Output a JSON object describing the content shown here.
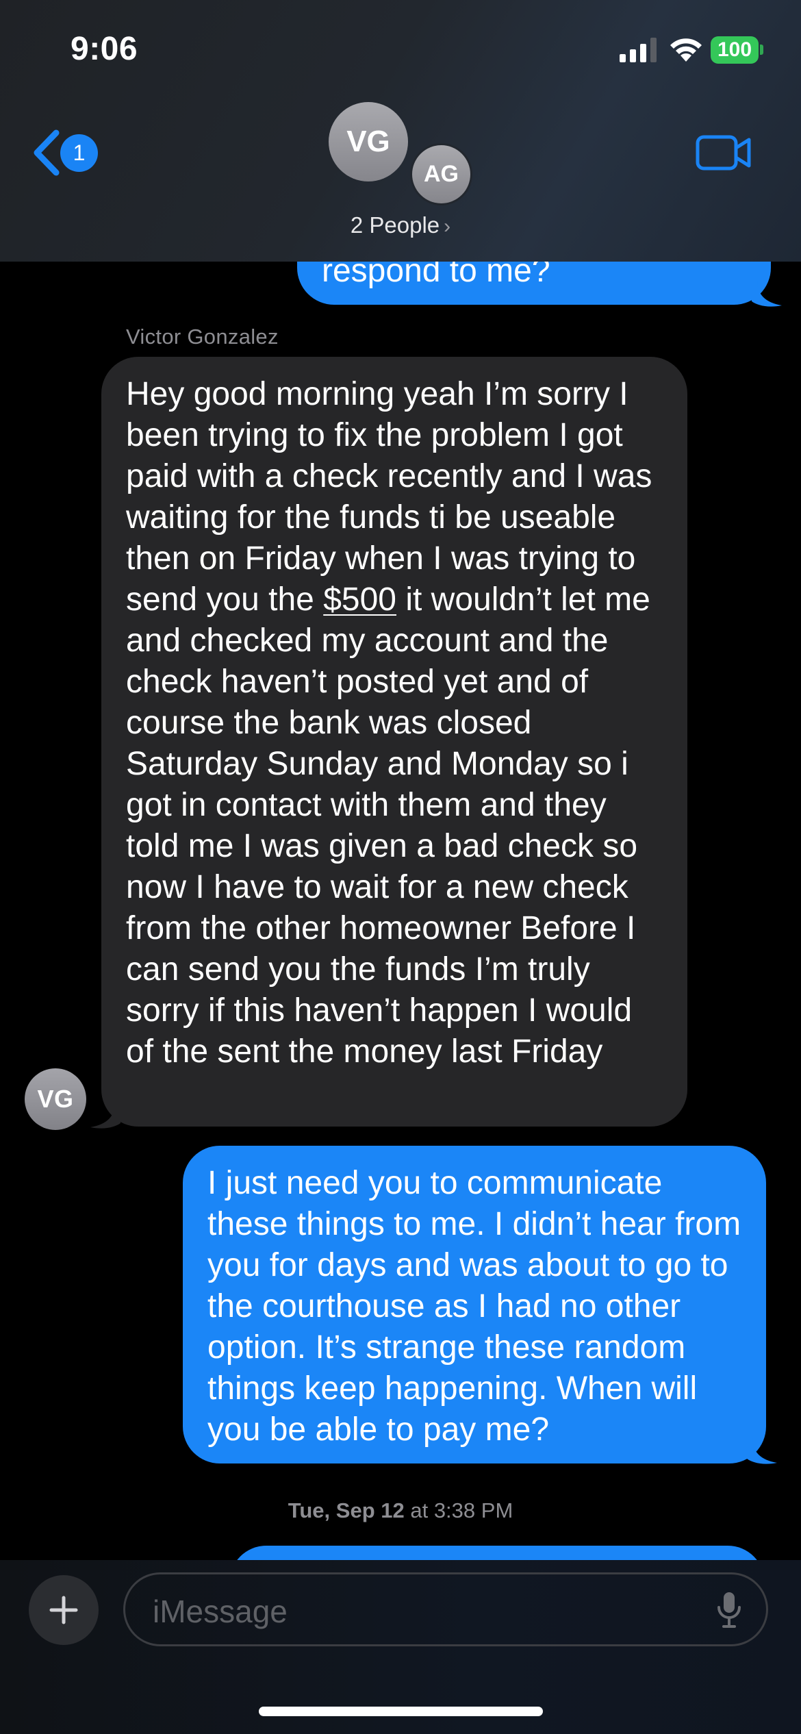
{
  "status_bar": {
    "time": "9:06",
    "battery": "100"
  },
  "header": {
    "back_badge_count": "1",
    "participants": [
      {
        "initials": "VG"
      },
      {
        "initials": "AG"
      }
    ],
    "people_label": "2 People",
    "chevron": "›"
  },
  "messages": [
    {
      "direction": "outgoing",
      "text": "respond to me?"
    },
    {
      "direction": "incoming",
      "sender": "Victor Gonzalez",
      "sender_initials": "VG",
      "text_before": "Hey good morning yeah I’m sorry I been trying to fix the problem I got paid with a check recently and I was waiting for the funds ti be useable then on Friday when I was trying to send you the ",
      "link_text": "$500",
      "text_after": " it wouldn’t let me and checked my account and the check haven’t posted yet and of course the bank was closed Saturday Sunday and Monday so i got in contact with them and they told me I was given a bad check so now I have to wait for a new check from the other homeowner Before I can send you the funds I’m truly sorry if this haven’t happen I would of the sent the money last Friday"
    },
    {
      "direction": "outgoing",
      "text": "I just need you to communicate these things to me. I didn’t hear from you for days and was about to go to the courthouse as I had no other option. It’s strange these random things keep happening. When will you be able to pay me?"
    }
  ],
  "timestamp": {
    "date": "Tue, Sep 12",
    "time": " at 3:38 PM"
  },
  "composer": {
    "placeholder": "iMessage"
  },
  "colors": {
    "outgoing": "#1b86f7",
    "incoming": "#262628",
    "accent": "#1a84f5",
    "battery": "#34c759"
  },
  "icons": [
    "back-chevron-icon",
    "video-camera-icon",
    "plus-icon",
    "microphone-icon",
    "cellular-signal-icon",
    "wifi-icon",
    "battery-icon"
  ]
}
